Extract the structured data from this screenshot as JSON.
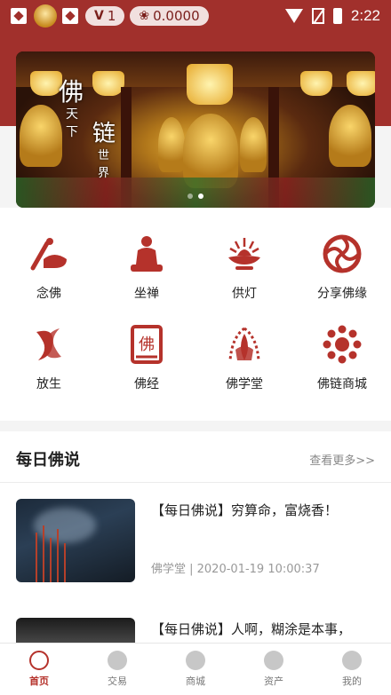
{
  "status_bar": {
    "time": "2:22",
    "level_badge": "1",
    "lotus_balance": "0.0000"
  },
  "banner": {
    "calligraphy_1": "佛",
    "calligraphy_2": "天",
    "calligraphy_3": "下",
    "calligraphy_4": "链",
    "calligraphy_5": "世",
    "calligraphy_6": "界",
    "slide_count": 2,
    "active_slide": 2
  },
  "features": [
    {
      "label": "念佛",
      "icon": "chanting-icon"
    },
    {
      "label": "坐禅",
      "icon": "meditation-icon"
    },
    {
      "label": "供灯",
      "icon": "lotus-lamp-icon"
    },
    {
      "label": "分享佛缘",
      "icon": "share-wheel-icon"
    },
    {
      "label": "放生",
      "icon": "fish-release-icon"
    },
    {
      "label": "佛经",
      "icon": "sutra-book-icon"
    },
    {
      "label": "佛学堂",
      "icon": "buddhist-hall-icon"
    },
    {
      "label": "佛链商城",
      "icon": "mall-icon"
    }
  ],
  "daily": {
    "title": "每日佛说",
    "more": "查看更多>>",
    "articles": [
      {
        "title": "【每日佛说】穷算命，富烧香！",
        "meta": "佛学堂 | 2020-01-19 10:00:37"
      },
      {
        "title": "【每日佛说】人啊，糊涂是本事，"
      }
    ]
  },
  "tabs": [
    {
      "label": "首页",
      "icon": "home-icon"
    },
    {
      "label": "交易",
      "icon": "trade-icon"
    },
    {
      "label": "商城",
      "icon": "mall-icon"
    },
    {
      "label": "资产",
      "icon": "assets-icon"
    },
    {
      "label": "我的",
      "icon": "profile-icon"
    }
  ],
  "colors": {
    "brand_red": "#a1302c",
    "icon_red": "#b5322b"
  }
}
